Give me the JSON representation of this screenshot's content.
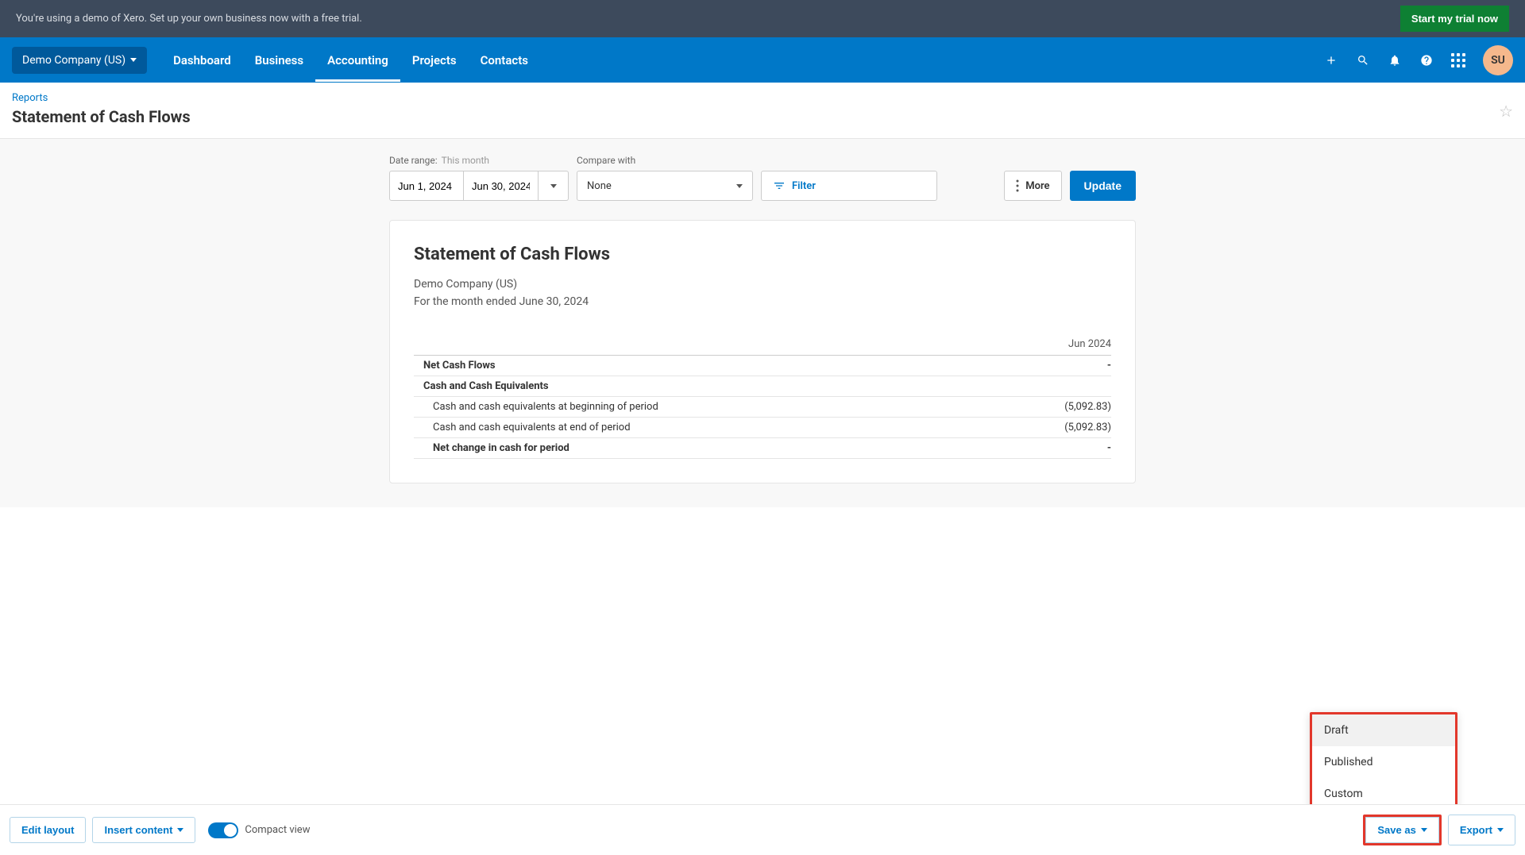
{
  "demo_banner": {
    "text": "You're using a demo of Xero. Set up your own business now with a free trial.",
    "trial_button": "Start my trial now"
  },
  "nav": {
    "company": "Demo Company (US)",
    "links": [
      "Dashboard",
      "Business",
      "Accounting",
      "Projects",
      "Contacts"
    ],
    "avatar": "SU"
  },
  "page": {
    "breadcrumb": "Reports",
    "title": "Statement of Cash Flows"
  },
  "controls": {
    "date_range_label": "Date range:",
    "date_range_value": "This month",
    "date_from": "Jun 1, 2024",
    "date_to": "Jun 30, 2024",
    "compare_label": "Compare with",
    "compare_value": "None",
    "filter_label": "Filter",
    "more_label": "More",
    "update_label": "Update"
  },
  "report": {
    "title": "Statement of Cash Flows",
    "company": "Demo Company (US)",
    "period": "For the month ended June 30, 2024",
    "column_header": "Jun 2024",
    "rows": [
      {
        "label": "Net Cash Flows",
        "value": "-",
        "cls": "section-head indent"
      },
      {
        "label": "Cash and Cash Equivalents",
        "value": "",
        "cls": "section-head indent"
      },
      {
        "label": "Cash and cash equivalents at beginning of period",
        "value": "(5,092.83)",
        "cls": "indent-more"
      },
      {
        "label": "Cash and cash equivalents at end of period",
        "value": "(5,092.83)",
        "cls": "indent-more"
      },
      {
        "label": "Net change in cash for period",
        "value": "-",
        "cls": "section-head indent-more"
      }
    ]
  },
  "saveas_menu": {
    "items": [
      "Draft",
      "Published",
      "Custom"
    ]
  },
  "bottom": {
    "edit_layout": "Edit layout",
    "insert_content": "Insert content",
    "compact_view": "Compact view",
    "save_as": "Save as",
    "export": "Export"
  }
}
